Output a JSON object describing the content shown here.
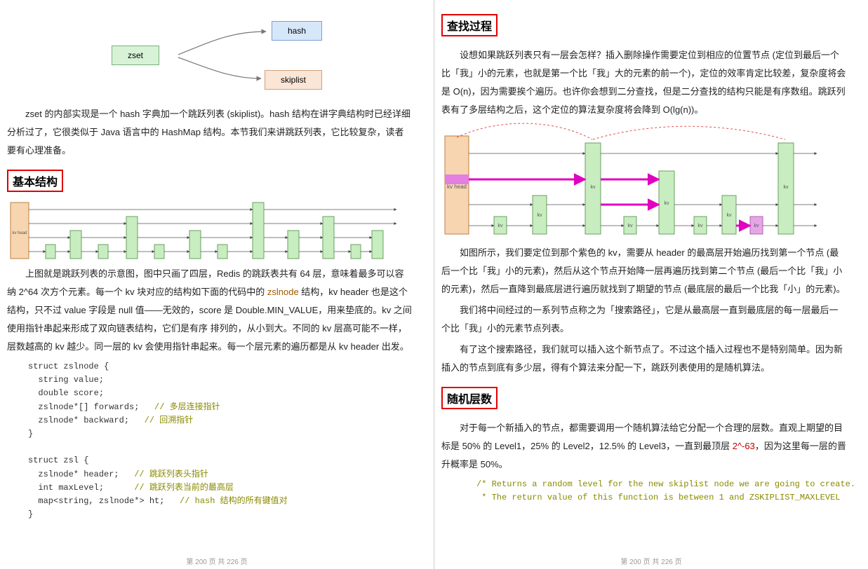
{
  "diagram": {
    "zset": "zset",
    "hash": "hash",
    "skiplist": "skiplist"
  },
  "left": {
    "intro": "zset 的内部实现是一个 hash 字典加一个跳跃列表 (skiplist)。hash 结构在讲字典结构时已经详细分析过了，它很类似于 Java 语言中的 HashMap 结构。本节我们来讲跳跃列表，它比较复杂，读者要有心理准备。",
    "heading_basic": "基本结构",
    "p1_a": "上图就是跳跃列表的示意图，图中只画了四层，Redis 的跳跃表共有 64 层，意味着最多可以容纳 2^64 次方个元素。每一个 kv 块对应的结构如下面的代码中的 ",
    "p1_red": "zslnode",
    "p1_b": " 结构，kv header 也是这个结构，只不过 value 字段是 null 值——无效的，score 是 Double.MIN_VALUE，用来垫底的。kv 之间使用指针串起来形成了双向链表结构，它们是有序 排列的，从小到大。不同的 kv 层高可能不一样，层数越高的 kv 越少。同一层的 kv 会使用指针串起来。每一个层元素的遍历都是从 kv header 出发。",
    "code1_l1": "struct zslnode {",
    "code1_l2": "  string value;",
    "code1_l3": "  double score;",
    "code1_l4": "  zslnode*[] forwards;   ",
    "code1_l4c": "// 多层连接指针",
    "code1_l5": "  zslnode* backward;   ",
    "code1_l5c": "// 回溯指针",
    "code1_l6": "}",
    "code2_l1": "struct zsl {",
    "code2_l2": "  zslnode* header;   ",
    "code2_l2c": "// 跳跃列表头指针",
    "code2_l3": "  int maxLevel;      ",
    "code2_l3c": "// 跳跃列表当前的最高层",
    "code2_l4": "  map<string, zslnode*> ht;   ",
    "code2_l4c": "// hash 结构的所有键值对",
    "code2_l5": "}",
    "footer": "第 200 页 共 226 页"
  },
  "right": {
    "heading_search": "查找过程",
    "p1": "设想如果跳跃列表只有一层会怎样？插入删除操作需要定位到相应的位置节点 (定位到最后一个比「我」小的元素，也就是第一个比「我」大的元素的前一个)，定位的效率肯定比较差，复杂度将会是 O(n)，因为需要挨个遍历。也许你会想到二分查找，但是二分查找的结构只能是有序数组。跳跃列表有了多层结构之后，这个定位的算法复杂度将会降到 O(lg(n))。",
    "p2": "如图所示，我们要定位到那个紫色的 kv，需要从 header 的最高层开始遍历找到第一个节点 (最后一个比「我」小的元素)，然后从这个节点开始降一层再遍历找到第二个节点 (最后一个比「我」小的元素)，然后一直降到最底层进行遍历就找到了期望的节点 (最底层的最后一个比我「小」的元素)。",
    "p3": "我们将中间经过的一系列节点称之为「搜索路径」，它是从最高层一直到最底层的每一层最后一个比「我」小的元素节点列表。",
    "p4": "有了这个搜索路径，我们就可以插入这个新节点了。不过这个插入过程也不是特别简单。因为新插入的节点到底有多少层，得有个算法来分配一下，跳跃列表使用的是随机算法。",
    "heading_random": "随机层数",
    "p5_a": "对于每一个新插入的节点，都需要调用一个随机算法给它分配一个合理的层数。直观上期望的目标是 50% 的 Level1，25% 的 Level2，12.5% 的 Level3，一直到最顶层 ",
    "p5_red": "2^-63",
    "p5_b": "，因为这里每一层的晋升概率是 50%。",
    "code_c1": "/* Returns a random level for the new skiplist node we are going to create.",
    "code_c2": " * The return value of this function is between 1 and ZSKIPLIST_MAXLEVEL",
    "footer": "第 200 页 共 226 页",
    "kv_head_label": "kv head",
    "kv_label": "kv"
  }
}
